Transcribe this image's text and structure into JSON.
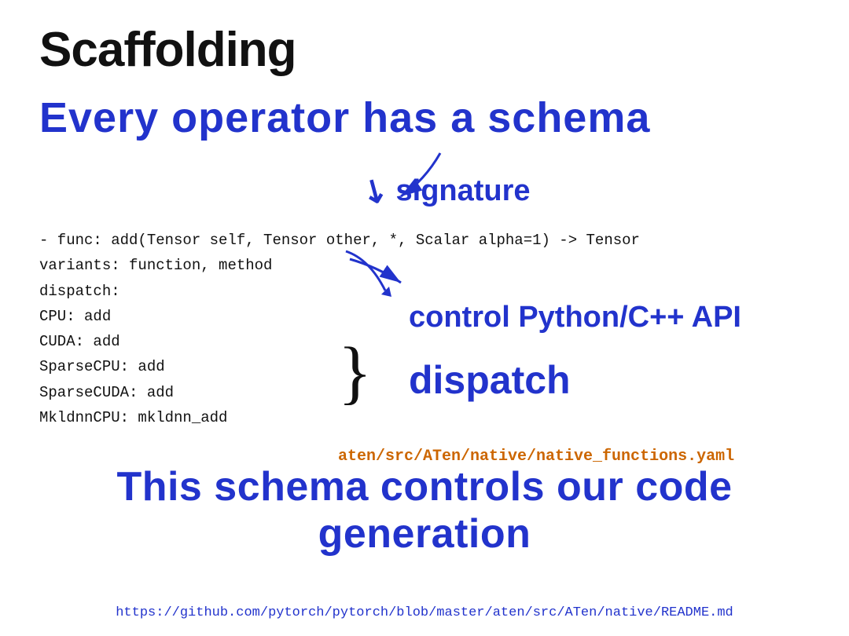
{
  "slide": {
    "title": "Scaffolding",
    "headline": "Every operator  has  a  schema",
    "signature_label": "signature",
    "code": {
      "line1": "- func: add(Tensor self, Tensor other, *, Scalar alpha=1) -> Tensor",
      "line2": "  variants: function, method",
      "line3": "  dispatch:",
      "line4": "    CPU: add",
      "line5": "    CUDA: add",
      "line6": "    SparseCPU: add",
      "line7": "    SparseCUDA: add",
      "line8": "    MkldnnCPU: mkldnn_add"
    },
    "control_label": "control Python/C++ API",
    "dispatch_label": "dispatch",
    "filepath": "aten/src/ATen/native/native_functions.yaml",
    "bottom_headline": "This schema controls our code generation",
    "url": "https://github.com/pytorch/pytorch/blob/master/aten/src/ATen/native/README.md"
  }
}
